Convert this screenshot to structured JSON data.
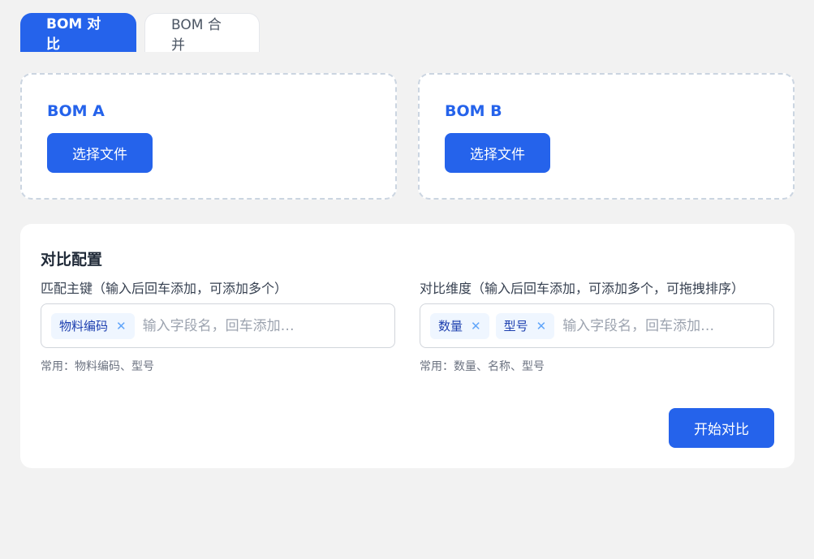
{
  "tabs": [
    {
      "label": "BOM 对比",
      "active": true
    },
    {
      "label": "BOM 合并",
      "active": false
    }
  ],
  "upload": {
    "a": {
      "title": "BOM A",
      "button": "选择文件"
    },
    "b": {
      "title": "BOM B",
      "button": "选择文件"
    }
  },
  "config": {
    "title": "对比配置",
    "keys": {
      "label": "匹配主键（输入后回车添加，可添加多个）",
      "tags": [
        "物料编码"
      ],
      "placeholder": "输入字段名，回车添加…",
      "hint": "常用：物料编码、型号"
    },
    "dims": {
      "label": "对比维度（输入后回车添加，可添加多个，可拖拽排序）",
      "tags": [
        "数量",
        "型号"
      ],
      "placeholder": "输入字段名，回车添加…",
      "hint": "常用：数量、名称、型号"
    },
    "start_button": "开始对比"
  },
  "icons": {
    "tag_remove": "close-icon"
  },
  "colors": {
    "accent": "#2563eb",
    "tag_bg": "#eff6ff",
    "tag_text": "#1e40af"
  }
}
